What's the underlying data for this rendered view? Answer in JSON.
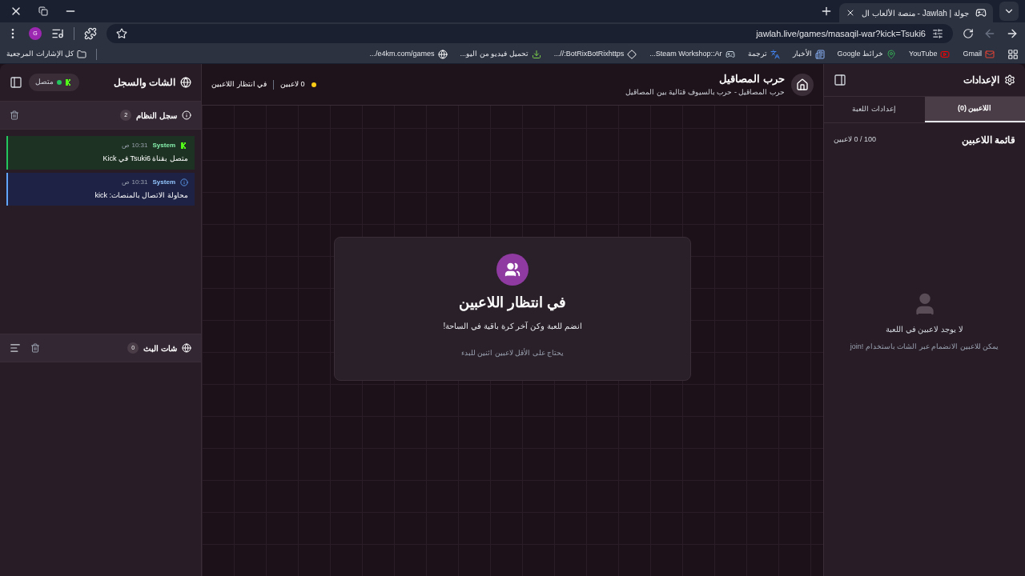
{
  "browser": {
    "tab": {
      "title": "جولة | Jawlah - منصة الألعاب ال",
      "selected": true
    },
    "profile": "G",
    "url": "jawlah.live/games/masaqil-war?kick=Tsuki6",
    "bookmarks": [
      {
        "label": "Gmail",
        "kind": "gmail"
      },
      {
        "label": "YouTube",
        "kind": "youtube"
      },
      {
        "label": "خرائط Google",
        "kind": "maps"
      },
      {
        "label": "الأخبار",
        "kind": "news"
      },
      {
        "label": "ترجمة",
        "kind": "translate"
      },
      {
        "label": "Steam Workshop::Ar...",
        "kind": "steam"
      },
      {
        "label": "BotRixBotRixhttps://...",
        "kind": "diamond"
      },
      {
        "label": "تحميل فيديو من اليو...",
        "kind": "download"
      },
      {
        "label": "e4km.com/games/...",
        "kind": "globe"
      }
    ],
    "all_bookmarks": "كل الإشارات المرجعية"
  },
  "settings_panel": {
    "title": "الإعدادات",
    "tabs": [
      {
        "label": "اللاعبين (0)",
        "selected": true
      },
      {
        "label": "إعدادات اللعبة",
        "selected": false
      }
    ],
    "list_title": "قائمة اللاعبين",
    "count": "100 / 0 لاعبين",
    "empty_title": "لا يوجد لاعبين في اللعبة",
    "empty_hint": "يمكن للاعبين الانضمام عبر الشات باستخدام !join"
  },
  "game_header": {
    "title": "حرب المصاقيل",
    "subtitle": "حرب المصاقيل - حرب بالسيوف قتالية بين المصاقيل",
    "players": "0 لاعبين",
    "status": "في انتظار اللاعبين"
  },
  "waiting_card": {
    "title": "في انتظار اللاعبين",
    "subtitle": "انضم للعبة وكن آخر كرة باقية في الساحة!",
    "hint": "يحتاج على الأقل لاعبين اثنين للبدء"
  },
  "chat_panel": {
    "title": "الشات والسجل",
    "connection": "متصل",
    "connected": true,
    "system_log": {
      "title": "سجل النظام",
      "count": "2",
      "entries": [
        {
          "kind": "kick",
          "author": "System",
          "time": "10:31 ص",
          "text": "متصل بقناة Tsuki6 في Kick"
        },
        {
          "kind": "system",
          "author": "System",
          "time": "10:31 ص",
          "text": "محاولة الاتصال بالمنصات: kick"
        }
      ]
    },
    "stream_chat": {
      "title": "شات البث",
      "count": "0"
    }
  }
}
